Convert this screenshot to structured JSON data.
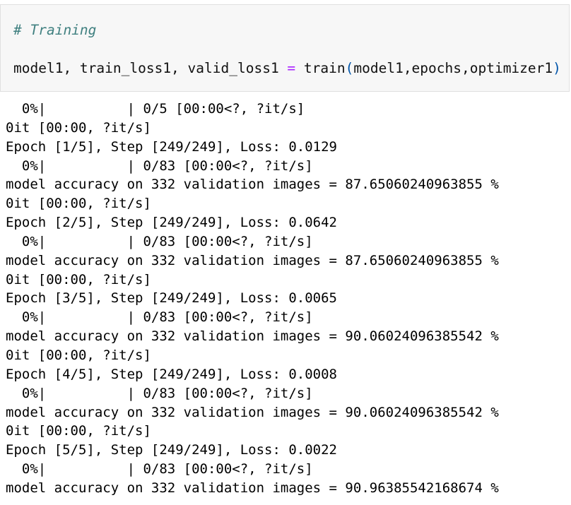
{
  "input_cell": {
    "comment": "# Training",
    "code": {
      "lhs": "model1, train_loss1, valid_loss1 ",
      "op": "=",
      "func": " train",
      "open_paren": "(",
      "args": "model1,epochs,optimizer1",
      "close_paren": ")"
    }
  },
  "output_lines": [
    "  0%|          | 0/5 [00:00<?, ?it/s]",
    "0it [00:00, ?it/s]",
    "Epoch [1/5], Step [249/249], Loss: 0.0129",
    "  0%|          | 0/83 [00:00<?, ?it/s]",
    "model accuracy on 332 validation images = 87.65060240963855 %",
    "0it [00:00, ?it/s]",
    "Epoch [2/5], Step [249/249], Loss: 0.0642",
    "  0%|          | 0/83 [00:00<?, ?it/s]",
    "model accuracy on 332 validation images = 87.65060240963855 %",
    "0it [00:00, ?it/s]",
    "Epoch [3/5], Step [249/249], Loss: 0.0065",
    "  0%|          | 0/83 [00:00<?, ?it/s]",
    "model accuracy on 332 validation images = 90.06024096385542 %",
    "0it [00:00, ?it/s]",
    "Epoch [4/5], Step [249/249], Loss: 0.0008",
    "  0%|          | 0/83 [00:00<?, ?it/s]",
    "model accuracy on 332 validation images = 90.06024096385542 %",
    "0it [00:00, ?it/s]",
    "Epoch [5/5], Step [249/249], Loss: 0.0022",
    "  0%|          | 0/83 [00:00<?, ?it/s]",
    "model accuracy on 332 validation images = 90.96385542168674 %"
  ],
  "colors": {
    "comment": "#408080",
    "operator": "#aa22ff",
    "paren": "#0055aa",
    "cell_background": "#f7f7f7"
  }
}
